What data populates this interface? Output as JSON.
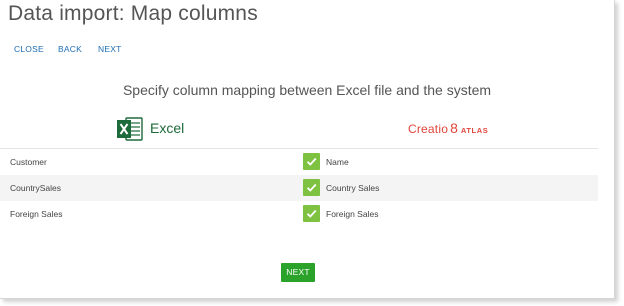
{
  "page": {
    "title": "Data import: Map columns"
  },
  "toolbar": {
    "close_label": "CLOSE",
    "back_label": "BACK",
    "next_label": "NEXT"
  },
  "subtitle": "Specify column mapping between Excel file and the system",
  "excel": {
    "logo_text": "Excel",
    "icon": "excel-icon",
    "brand_color": "#1d6a3a"
  },
  "creatio": {
    "brand": "Creatio",
    "version": "8",
    "edition": "ATLAS",
    "brand_color": "#e0453a"
  },
  "mappings": [
    {
      "source": "Customer",
      "target": "Name",
      "checked": true
    },
    {
      "source": "CountrySales",
      "target": "Country Sales",
      "checked": true
    },
    {
      "source": "Foreign Sales",
      "target": "Foreign Sales",
      "checked": true
    }
  ],
  "footer": {
    "next_label": "NEXT"
  },
  "colors": {
    "accent_link": "#1f6eb5",
    "check_green": "#7fc241",
    "button_green": "#2ba32b"
  }
}
